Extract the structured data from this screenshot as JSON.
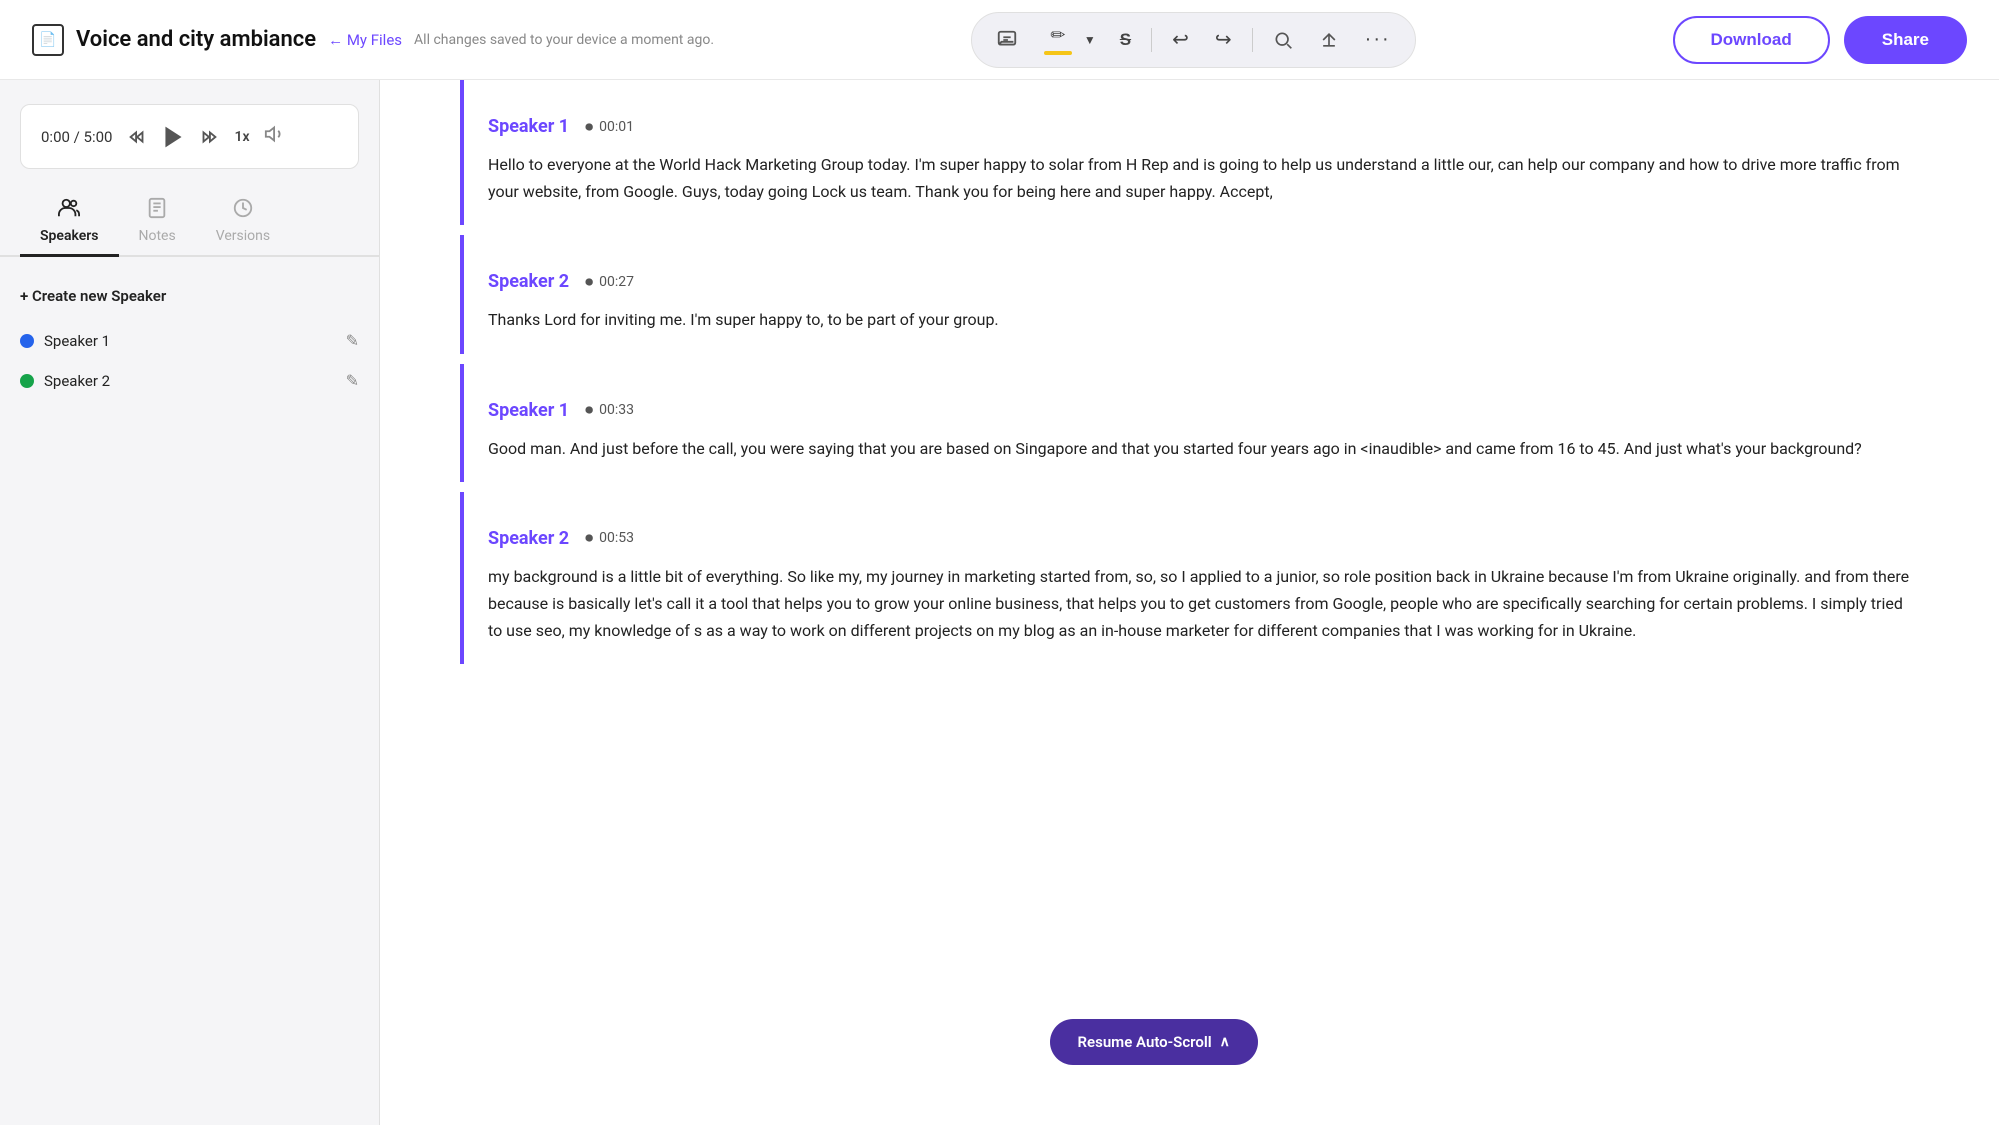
{
  "header": {
    "doc_icon": "📄",
    "title": "Voice and city ambiance",
    "back_label": "← My Files",
    "autosave": "All changes saved to your device a moment ago.",
    "download_label": "Download",
    "share_label": "Share"
  },
  "toolbar": {
    "comment_icon": "💬",
    "highlight_icon": "✏",
    "strikethrough_icon": "S",
    "undo_icon": "↩",
    "redo_icon": "↪",
    "search_icon": "🔍",
    "upload_icon": "⬆",
    "more_icon": "•••"
  },
  "player": {
    "time": "0:00 / 5:00",
    "speed": "1x"
  },
  "tabs": [
    {
      "label": "Speakers",
      "active": true
    },
    {
      "label": "Notes",
      "active": false
    },
    {
      "label": "Versions",
      "active": false
    }
  ],
  "speakers": [
    {
      "name": "Speaker 1",
      "color": "blue"
    },
    {
      "name": "Speaker 2",
      "color": "green"
    }
  ],
  "create_speaker_label": "+ Create new Speaker",
  "transcript": [
    {
      "speaker": "Speaker 1",
      "timestamp": "00:01",
      "text": "Hello to everyone at the World Hack Marketing Group today. I'm super happy to solar from H Rep and is going to help us understand a little our, can help our company and how to drive more traffic from your website, from Google. Guys, today going Lock us team. Thank you for being here and super happy. Accept,"
    },
    {
      "speaker": "Speaker 2",
      "timestamp": "00:27",
      "text": "Thanks Lord for inviting me. I'm super happy to, to be part of your group."
    },
    {
      "speaker": "Speaker 1",
      "timestamp": "00:33",
      "text": "Good man. And just before the call, you were saying that you are based on Singapore and that you started four years ago in <inaudible> and came from 16 to 45. And just what's your background?"
    },
    {
      "speaker": "Speaker 2",
      "timestamp": "00:53",
      "text": " my background is a little bit of everything. So like my, my journey in marketing started from, so, so I applied to a junior, so role position back in Ukraine because I'm from Ukraine originally. and from there because is basically let's call it a tool that helps you to grow your online business, that helps you to get customers from Google, people who are specifically searching for certain problems. I simply tried to use seo, my knowledge of s as a way to work on different projects on my blog as an in-house marketer for different companies that I was working for in Ukraine."
    }
  ],
  "resume_scroll_label": "Resume Auto-Scroll"
}
